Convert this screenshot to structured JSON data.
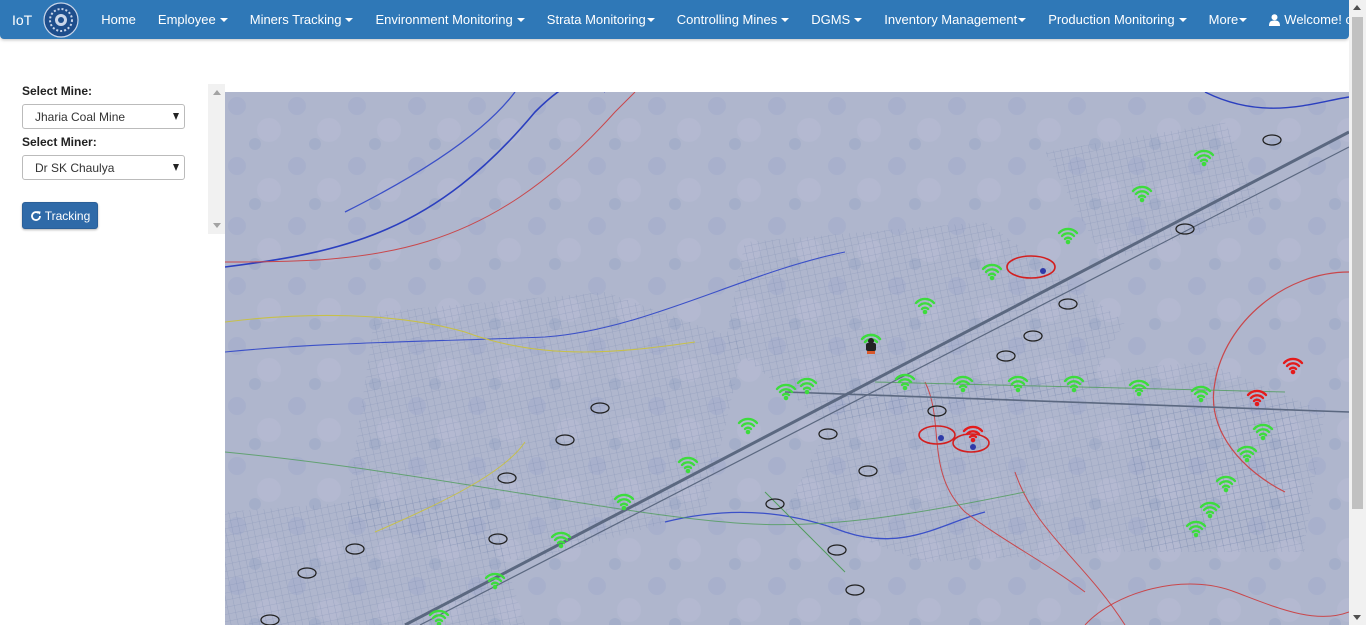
{
  "brand": {
    "text": "IoT"
  },
  "nav": {
    "home": "Home",
    "employee": "Employee",
    "miners_tracking": "Miners Tracking",
    "environment": "Environment Monitoring",
    "strata": "Strata Monitoring",
    "controlling": "Controlling Mines",
    "dgms": "DGMS",
    "inventory": "Inventory Management",
    "production": "Production Monitoring",
    "more": "More",
    "user": "Welcome! cimfr"
  },
  "form": {
    "mine_label": "Select Mine:",
    "mine_value": "Jharia Coal Mine",
    "miner_label": "Select Miner:",
    "miner_value": "Dr SK Chaulya",
    "tracking_button": "Tracking"
  },
  "map": {
    "active_color": "#3ddc3d",
    "alert_color": "#e41b1b",
    "green_nodes": 26,
    "red_nodes": 3
  },
  "icons": [
    "logo-emblem",
    "user-icon",
    "refresh-icon",
    "wifi-icon",
    "miner-icon"
  ]
}
